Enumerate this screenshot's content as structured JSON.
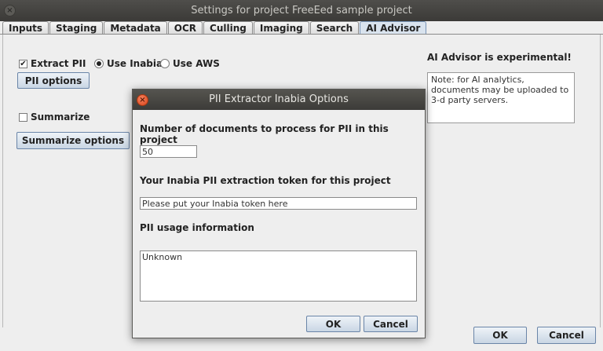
{
  "window": {
    "title": "Settings for project FreeEed sample project",
    "close_glyph": "×"
  },
  "tabs": [
    "Inputs",
    "Staging",
    "Metadata",
    "OCR",
    "Culling",
    "Imaging",
    "Search",
    "AI Advisor"
  ],
  "ai": {
    "extract_pii_label": "Extract PII",
    "extract_pii_checked": true,
    "use_inabia_label": "Use Inabia",
    "use_aws_label": "Use AWS",
    "pii_options_label": "PII options",
    "summarize_label": "Summarize",
    "summarize_checked": false,
    "summarize_options_label": "Summarize options",
    "experimental_heading": "AI Advisor is experimental!",
    "experimental_note": "Note: for AI analytics, documents may be uploaded to 3-d party servers."
  },
  "footer": {
    "ok_label": "OK",
    "cancel_label": "Cancel"
  },
  "dialog": {
    "title": "PII Extractor Inabia Options",
    "docs_label": "Number of documents to process for PII in this project",
    "docs_value": "50",
    "token_label": "Your Inabia PII extraction token for this project",
    "token_placeholder": "Please put your Inabia token here",
    "usage_label": "PII usage information",
    "usage_value": "Unknown",
    "ok_label": "OK",
    "cancel_label": "Cancel"
  },
  "check_glyph": "✔",
  "colors": {
    "titlebar": "#3b3a37",
    "selected_tab": "#d9e3ee",
    "close_button": "#d8431b"
  }
}
